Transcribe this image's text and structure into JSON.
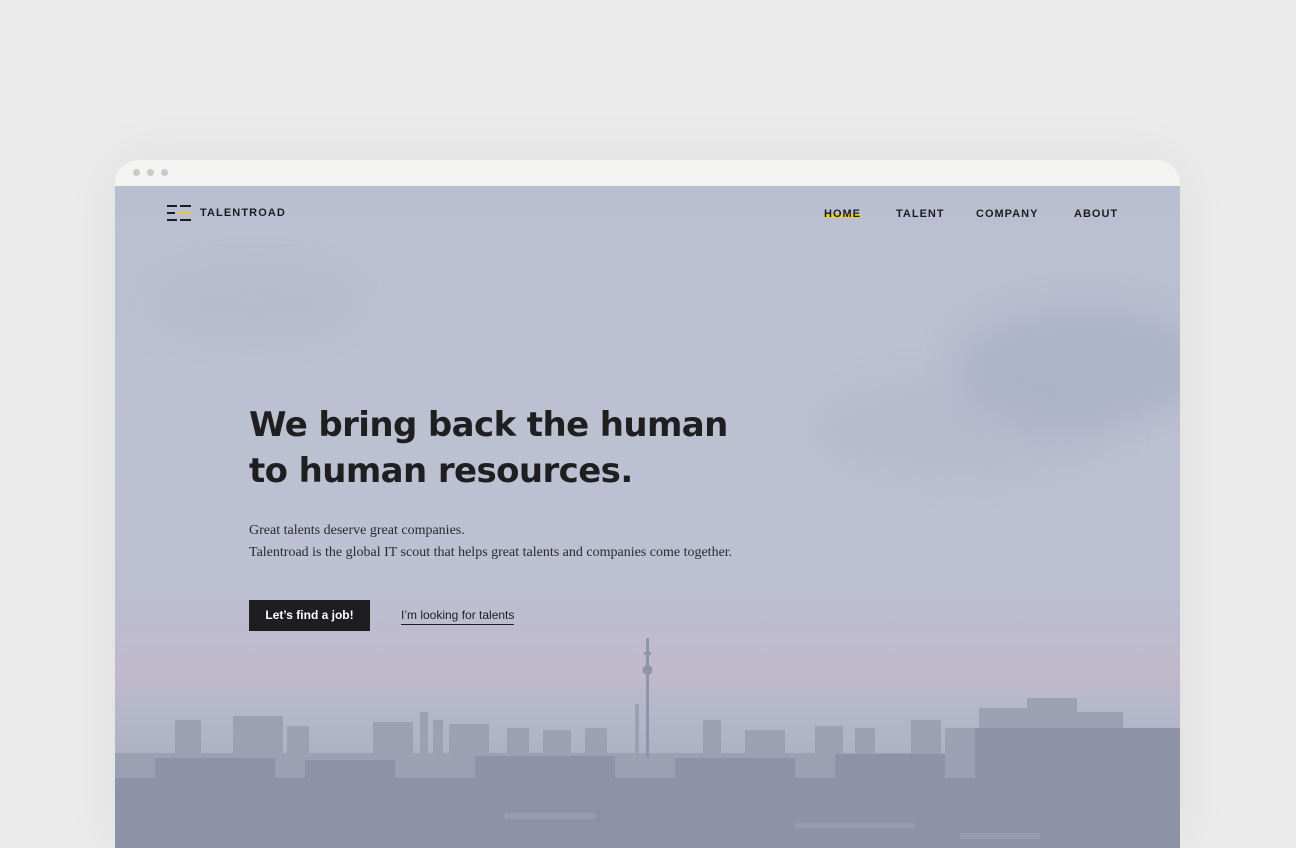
{
  "brand": {
    "name": "TALENTROAD",
    "accent_color": "#e5cb3a",
    "text_color": "#1d1d1f"
  },
  "nav": {
    "items": [
      {
        "label": "HOME",
        "active": true
      },
      {
        "label": "TALENT",
        "active": false
      },
      {
        "label": "COMPANY",
        "active": false
      },
      {
        "label": "ABOUT",
        "active": false
      }
    ]
  },
  "hero": {
    "headline_line1": "We bring back the human",
    "headline_line2": "to human resources.",
    "subtitle_line1": "Great talents deserve great companies.",
    "subtitle_line2": "Talentroad is the global IT scout that helps great talents and companies come together.",
    "primary_button": "Let’s find a job!",
    "secondary_link": "I’m looking for talents"
  }
}
